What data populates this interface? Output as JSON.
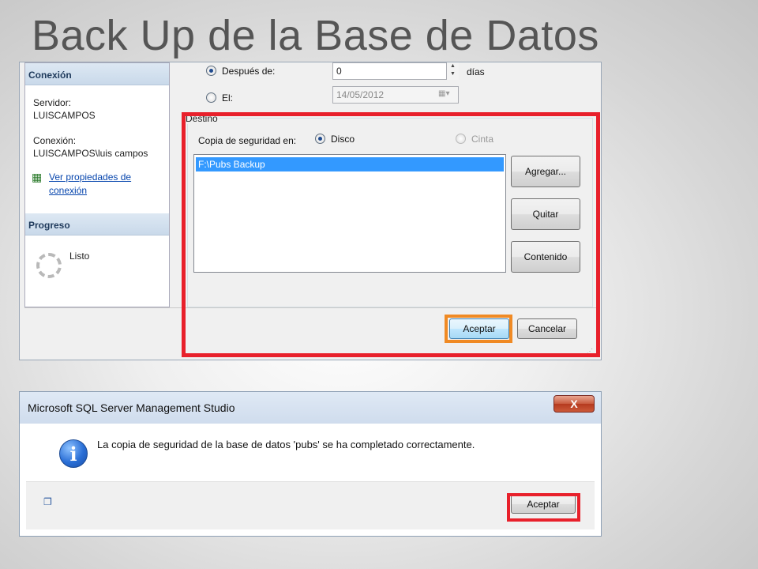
{
  "slide": {
    "title": "Back Up de la Base de Datos"
  },
  "backup_dialog": {
    "left_pane": {
      "connection_header": "Conexión",
      "server_label": "Servidor:",
      "server_value": "LUISCAMPOS",
      "connection_label": "Conexión:",
      "connection_value": "LUISCAMPOS\\luis campos",
      "view_props_link_line1": "Ver propiedades de",
      "view_props_link_line2": "conexión",
      "progress_header": "Progreso",
      "progress_status": "Listo"
    },
    "expiration": {
      "after_label": "Después de:",
      "after_value": "0",
      "days_label": "días",
      "on_label": "El:",
      "on_value": "14/05/2012"
    },
    "destination": {
      "legend": "Destino",
      "backup_to_label": "Copia de seguridad en:",
      "disk_label": "Disco",
      "tape_label": "Cinta",
      "list_items": [
        "F:\\Pubs Backup"
      ],
      "add_button": "Agregar...",
      "remove_button": "Quitar",
      "contents_button": "Contenido"
    },
    "ok_button": "Aceptar",
    "cancel_button": "Cancelar"
  },
  "message_box": {
    "title": "Microsoft SQL Server Management Studio",
    "close_glyph": "X",
    "icon": "info-icon",
    "message": "La copia de seguridad de la base de datos 'pubs' se ha completado correctamente.",
    "ok_button": "Aceptar"
  },
  "colors": {
    "highlight_red": "#e8202b",
    "highlight_orange": "#f08a24",
    "selection_blue": "#3399ff"
  }
}
